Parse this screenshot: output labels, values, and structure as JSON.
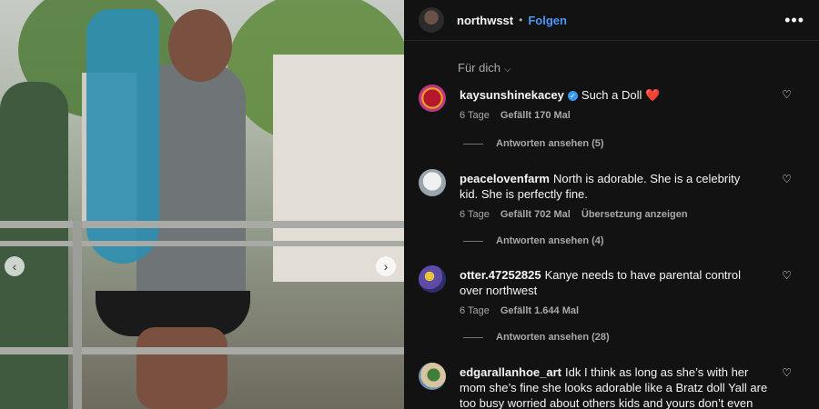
{
  "post": {
    "username": "northwsst",
    "separator": "•",
    "follow_label": "Folgen",
    "more_icon": "more-horizontal-icon"
  },
  "photo_nav": {
    "prev_icon": "chevron-left-icon",
    "next_icon": "chevron-right-icon",
    "prev_glyph": "‹",
    "next_glyph": "›"
  },
  "comments_sort": {
    "label": "Für dich",
    "icon": "chevron-down-icon"
  },
  "comments": [
    {
      "user": "kaysunshinekacey",
      "verified": true,
      "text": "Such a Doll",
      "emoji": "❤️",
      "time": "6 Tage",
      "likes": "Gefällt 170 Mal",
      "translate": "",
      "replies": "Antworten ansehen (5)"
    },
    {
      "user": "peacelovenfarm",
      "verified": false,
      "text": "North is adorable. She is a celebrity kid. She is perfectly fine.",
      "emoji": "",
      "time": "6 Tage",
      "likes": "Gefällt 702 Mal",
      "translate": "Übersetzung anzeigen",
      "replies": "Antworten ansehen (4)"
    },
    {
      "user": "otter.47252825",
      "verified": false,
      "text": "Kanye needs to have parental control over northwest",
      "emoji": "",
      "time": "6 Tage",
      "likes": "Gefällt 1.644 Mal",
      "translate": "",
      "replies": "Antworten ansehen (28)"
    },
    {
      "user": "edgarallanhoe_art",
      "verified": false,
      "text": "Idk I think as long as she’s with her mom she’s fine she looks adorable like a Bratz doll Yall are too busy worried about others kids and yours don’t even read",
      "emoji": "",
      "time": "",
      "likes": "",
      "translate": "",
      "replies": ""
    }
  ],
  "colors": {
    "panel_bg": "#121212",
    "link": "#4c97f8",
    "muted": "#a8a8a8",
    "heart": "#ff3040"
  }
}
